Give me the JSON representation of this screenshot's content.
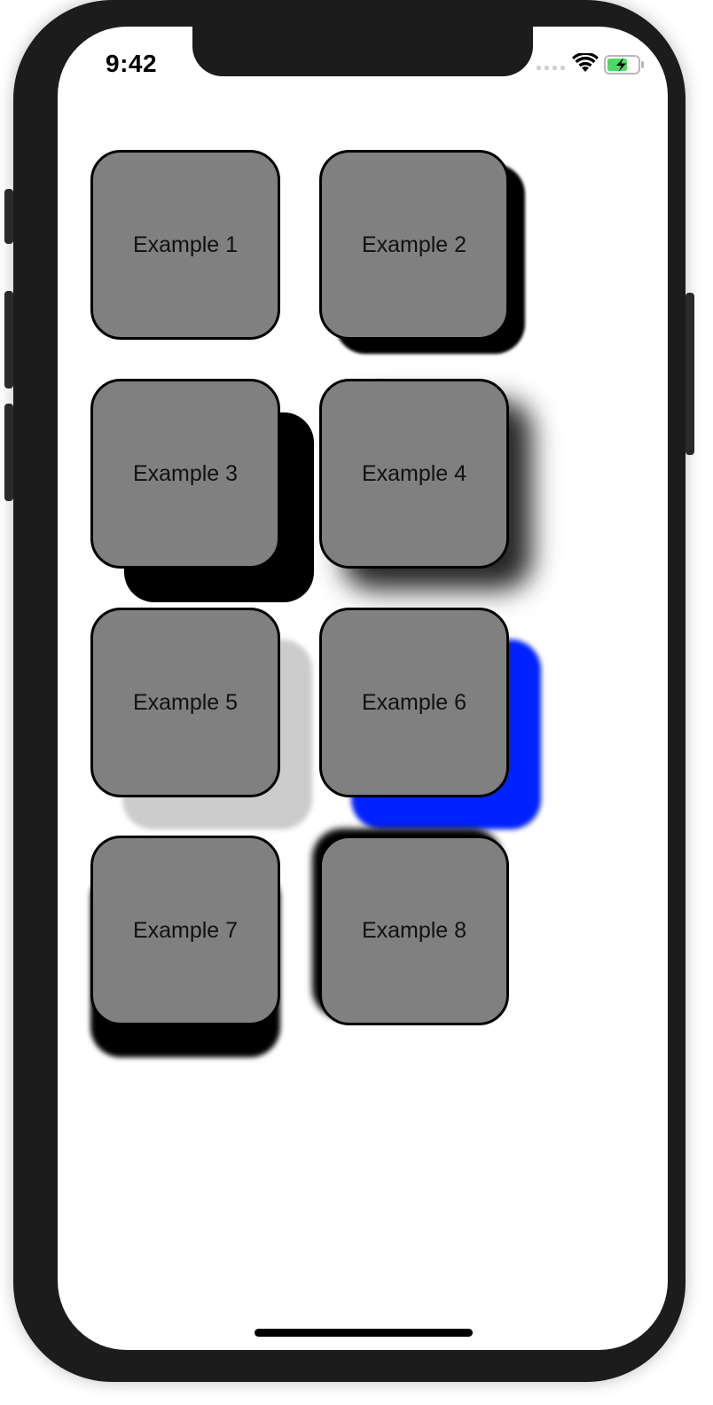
{
  "status_bar": {
    "time": "9:42",
    "signal_icon": "cellular-signal-icon",
    "wifi_icon": "wifi-icon",
    "battery_icon": "battery-charging-icon"
  },
  "cards": [
    {
      "label": "Example 1"
    },
    {
      "label": "Example 2"
    },
    {
      "label": "Example 3"
    },
    {
      "label": "Example 4"
    },
    {
      "label": "Example 5"
    },
    {
      "label": "Example 6"
    },
    {
      "label": "Example 7"
    },
    {
      "label": "Example 8"
    }
  ],
  "colors": {
    "card_fill": "#808080",
    "card_border": "#000000",
    "shadow_blue": "#0022ff",
    "shadow_light": "#cccccc",
    "device_frame": "#1c1c1c"
  }
}
